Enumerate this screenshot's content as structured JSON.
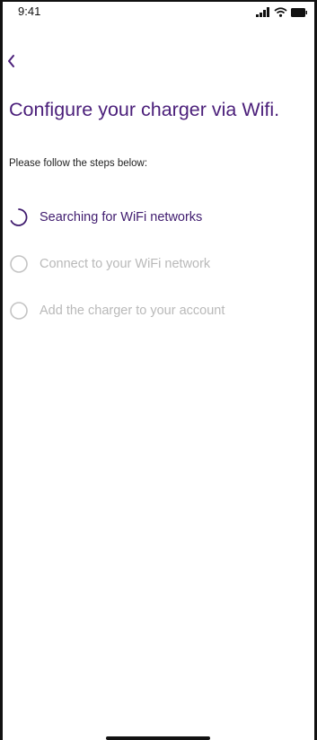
{
  "status_bar": {
    "time": "9:41",
    "icons": [
      "signal-icon",
      "wifi-icon",
      "battery-icon"
    ]
  },
  "header": {
    "back_icon": "chevron-left-icon"
  },
  "main": {
    "title": "Configure your charger via Wifi.",
    "subtitle": "Please follow the steps below:",
    "steps": [
      {
        "label": "Searching for WiFi networks",
        "state": "in-progress"
      },
      {
        "label": "Connect to your WiFi network",
        "state": "pending"
      },
      {
        "label": "Add the charger to your account",
        "state": "pending"
      }
    ]
  },
  "colors": {
    "accent": "#4b1f7a",
    "pending": "#b9b9b9",
    "text": "#222222"
  }
}
